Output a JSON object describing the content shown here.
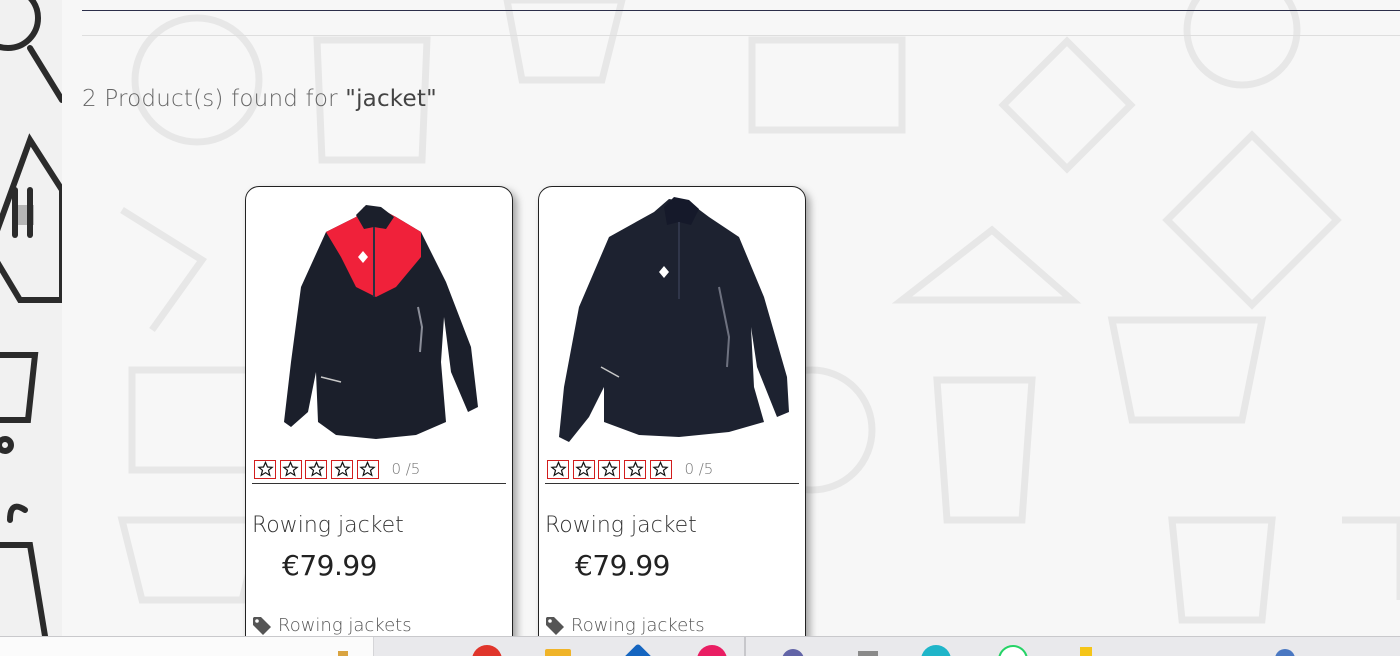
{
  "search": {
    "count_text": "2 Product(s) found for ",
    "query_text": "\"jacket\""
  },
  "products": [
    {
      "name": "Rowing jacket",
      "price": "€79.99",
      "rating_text": "0 /5",
      "rating_value": 0,
      "rating_max": 5,
      "category": "Rowing jackets",
      "image": "red-black-jacket-photo"
    },
    {
      "name": "Rowing jacket",
      "price": "€79.99",
      "rating_text": "0 /5",
      "rating_value": 0,
      "rating_max": 5,
      "category": "Rowing jackets",
      "image": "navy-jacket-photo"
    }
  ],
  "colors": {
    "star_border": "#d21d1d",
    "jacket_red": "#f0213a",
    "jacket_navy": "#1b1f2b",
    "card_border": "#222222"
  },
  "taskbar": {
    "icons": [
      "app-icon",
      "chrome-icon",
      "files-icon",
      "store-icon",
      "browser-icon",
      "teams-icon",
      "notes-icon",
      "edge-icon",
      "whatsapp-icon",
      "bolt-icon",
      "user-icon"
    ]
  }
}
